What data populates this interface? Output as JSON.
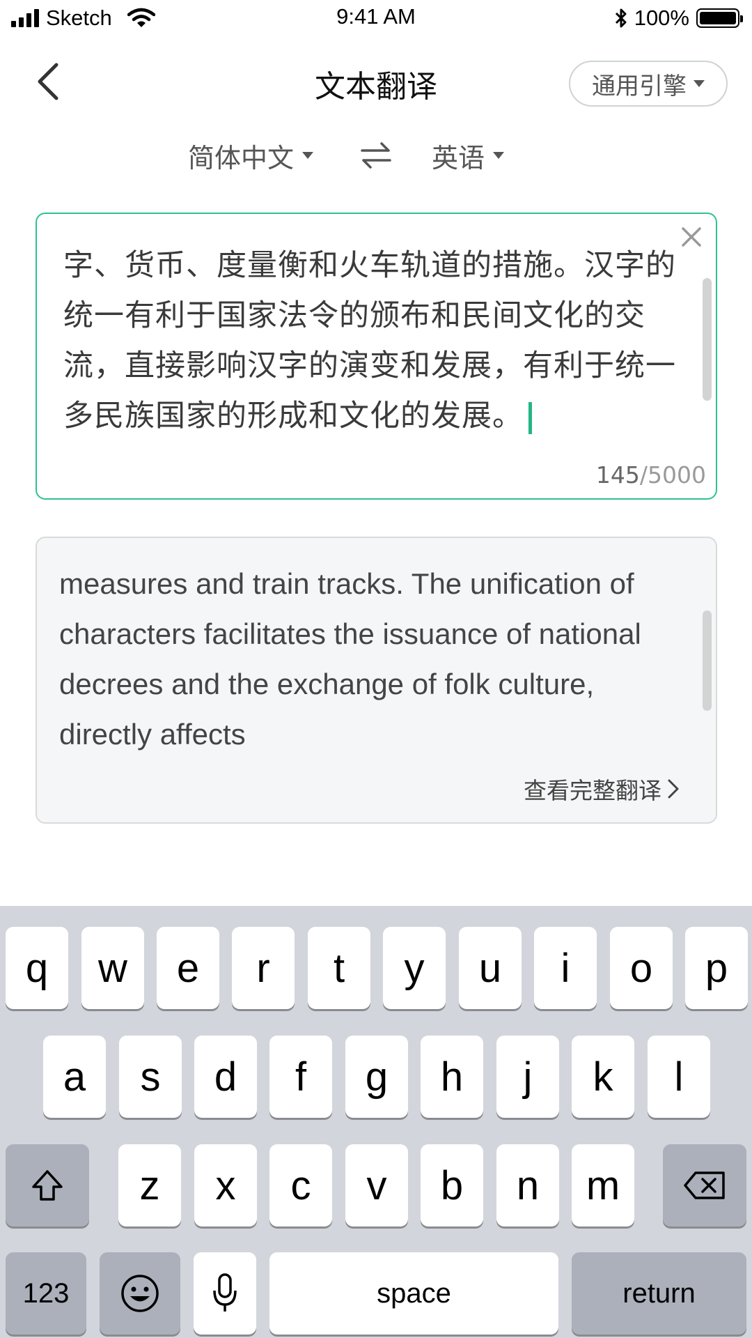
{
  "status_bar": {
    "carrier": "Sketch",
    "time": "9:41 AM",
    "battery_percent": "100%",
    "battery_level": 1.0
  },
  "nav": {
    "title": "文本翻译",
    "engine_label": "通用引擎"
  },
  "languages": {
    "source": "简体中文",
    "target": "英语"
  },
  "input": {
    "text": "字、货币、度量衡和火车轨道的措施。汉字的统一有利于国家法令的颁布和民间文化的交流，直接影响汉字的演变和发展，有利于统一多民族国家的形成和文化的发展。",
    "count_current": "145",
    "count_max": "/5000"
  },
  "output": {
    "text": "measures and train tracks. The unification of characters facilitates the issuance of national decrees and the exchange of folk culture, directly affects",
    "full_link": "查看完整翻译"
  },
  "keyboard": {
    "row1": [
      "q",
      "w",
      "e",
      "r",
      "t",
      "y",
      "u",
      "i",
      "o",
      "p"
    ],
    "row2": [
      "a",
      "s",
      "d",
      "f",
      "g",
      "h",
      "j",
      "k",
      "l"
    ],
    "row3": [
      "z",
      "x",
      "c",
      "v",
      "b",
      "n",
      "m"
    ],
    "numbers_label": "123",
    "space_label": "space",
    "return_label": "return"
  },
  "colors": {
    "accent": "#2ec28e",
    "keyboard_bg": "#d2d5db"
  }
}
